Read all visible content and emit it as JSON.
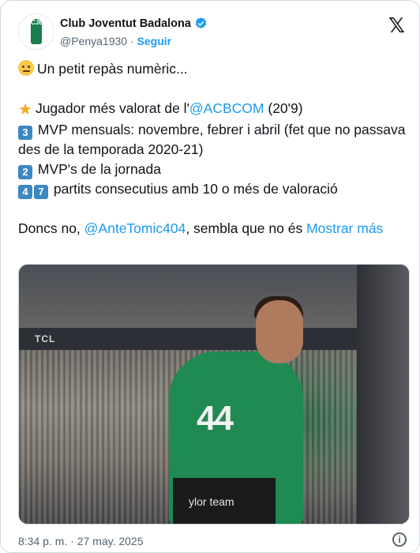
{
  "author": {
    "name": "Club Joventut Badalona",
    "handle": "@Penya1930",
    "separator": "·",
    "follow_label": "Seguir",
    "verified": true,
    "logo_text": "CJB"
  },
  "tweet": {
    "line1": "Un petit repàs numèric...",
    "line2_prefix": "Jugador més valorat de l'",
    "line2_mention": "@ACBCOM",
    "line2_suffix": " (20'9)",
    "line3_key": "3",
    "line3_text": " MVP mensuals: novembre, febrer i abril (fet que no passava des de la temporada 2020-21)",
    "line4_key": "2",
    "line4_text": " MVP's de la jornada",
    "line5_key1": "4",
    "line5_key2": "7",
    "line5_text": " partits consecutius amb 10 o més de valoració",
    "line6_prefix": "Doncs no, ",
    "line6_mention": "@AnteTomic404",
    "line6_suffix": ", sembla que no és ",
    "show_more": "Mostrar más"
  },
  "media": {
    "board_text": "TCL",
    "jersey_number": "44",
    "shorts_text": "ylor team"
  },
  "footer": {
    "timestamp": "8:34 p. m. · 27 may. 2025"
  },
  "colors": {
    "link": "#1d9bf0",
    "text": "#0f1419",
    "muted": "#536471"
  },
  "icons": [
    "verified-badge-icon",
    "x-logo-icon",
    "info-icon",
    "face-emoji",
    "star-emoji",
    "keycap-emoji"
  ]
}
